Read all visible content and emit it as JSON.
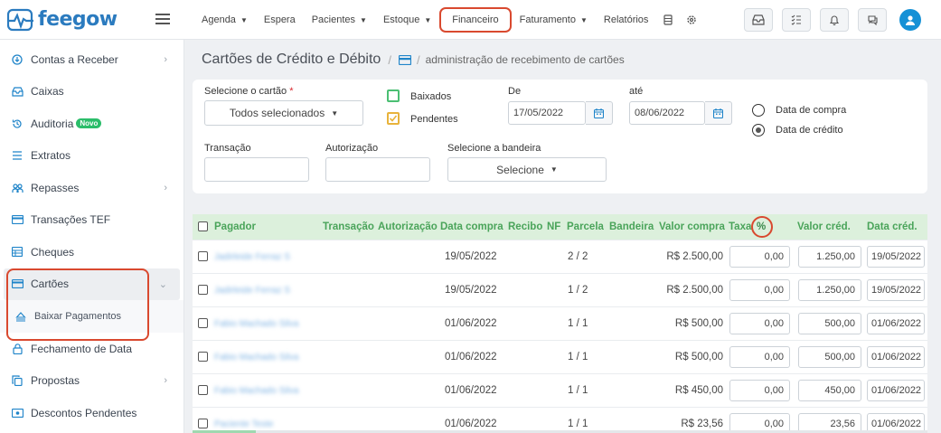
{
  "brand": {
    "name": "feegow",
    "color": "#2b7bbf"
  },
  "nav": [
    {
      "label": "Agenda",
      "caret": true
    },
    {
      "label": "Espera",
      "caret": false
    },
    {
      "label": "Pacientes",
      "caret": true
    },
    {
      "label": "Estoque",
      "caret": true
    },
    {
      "label": "Financeiro",
      "caret": false,
      "highlighted": true
    },
    {
      "label": "Faturamento",
      "caret": true
    },
    {
      "label": "Relatórios",
      "caret": false
    }
  ],
  "sidebar": {
    "items": [
      {
        "label": "Contas a Receber",
        "icon": "circle-arrow-icon",
        "chevron": true
      },
      {
        "label": "Caixas",
        "icon": "inbox-icon"
      },
      {
        "label": "Auditoria",
        "icon": "history-icon",
        "badge": "Novo"
      },
      {
        "label": "Extratos",
        "icon": "list-icon"
      },
      {
        "label": "Repasses",
        "icon": "users-icon",
        "chevron": true
      },
      {
        "label": "Transações TEF",
        "icon": "card-icon"
      },
      {
        "label": "Cheques",
        "icon": "table-icon"
      },
      {
        "label": "Cartões",
        "icon": "card-icon",
        "chevron": true,
        "active": true
      },
      {
        "label": "Fechamento de Data",
        "icon": "lock-icon"
      },
      {
        "label": "Propostas",
        "icon": "copy-icon",
        "chevron": true
      },
      {
        "label": "Descontos Pendentes",
        "icon": "ticket-icon"
      }
    ],
    "submenu_label": "Baixar Pagamentos"
  },
  "header": {
    "title": "Cartões de Crédito e Débito",
    "breadcrumb": "administração de recebimento de cartões"
  },
  "filters": {
    "card_label": "Selecione o cartão",
    "card_value": "Todos selecionados",
    "baixados_label": "Baixados",
    "pendentes_label": "Pendentes",
    "de_label": "De",
    "de_value": "17/05/2022",
    "ate_label": "até",
    "ate_value": "08/06/2022",
    "radio_compra": "Data de compra",
    "radio_credito": "Data de crédito",
    "transacao_label": "Transação",
    "autorizacao_label": "Autorização",
    "bandeira_label": "Selecione a bandeira",
    "bandeira_value": "Selecione"
  },
  "table": {
    "headers": {
      "pagador": "Pagador",
      "transacao": "Transação",
      "autorizacao": "Autorização",
      "data_compra": "Data compra",
      "recibo": "Recibo",
      "nf": "NF",
      "parcela": "Parcela",
      "bandeira": "Bandeira",
      "valor_compra": "Valor compra",
      "taxa": "Taxa",
      "pct": "%",
      "valor_cred": "Valor créd.",
      "data_cred": "Data créd."
    },
    "rows": [
      {
        "pagador": "Jadirleide Ferraz S",
        "data_compra": "19/05/2022",
        "parcela": "2 / 2",
        "valor_compra": "R$ 2.500,00",
        "taxa": "0,00",
        "valor_cred": "1.250,00",
        "data_cred": "19/05/2022"
      },
      {
        "pagador": "Jadirleide Ferraz S",
        "data_compra": "19/05/2022",
        "parcela": "1 / 2",
        "valor_compra": "R$ 2.500,00",
        "taxa": "0,00",
        "valor_cred": "1.250,00",
        "data_cred": "19/05/2022"
      },
      {
        "pagador": "Fabio Machado Silva",
        "data_compra": "01/06/2022",
        "parcela": "1 / 1",
        "valor_compra": "R$ 500,00",
        "taxa": "0,00",
        "valor_cred": "500,00",
        "data_cred": "01/06/2022"
      },
      {
        "pagador": "Fabio Machado Silva",
        "data_compra": "01/06/2022",
        "parcela": "1 / 1",
        "valor_compra": "R$ 500,00",
        "taxa": "0,00",
        "valor_cred": "500,00",
        "data_cred": "01/06/2022"
      },
      {
        "pagador": "Fabio Machado Silva",
        "data_compra": "01/06/2022",
        "parcela": "1 / 1",
        "valor_compra": "R$ 450,00",
        "taxa": "0,00",
        "valor_cred": "450,00",
        "data_cred": "01/06/2022"
      },
      {
        "pagador": "Paciente Teste",
        "data_compra": "01/06/2022",
        "parcela": "1 / 1",
        "valor_compra": "R$ 23,56",
        "taxa": "0,00",
        "valor_cred": "23,56",
        "data_cred": "01/06/2022"
      }
    ]
  },
  "colors": {
    "accent": "#1f84c9",
    "highlight": "#d9492f",
    "table_header_bg": "#dcf0dc",
    "table_header_text": "#4aa45a"
  }
}
